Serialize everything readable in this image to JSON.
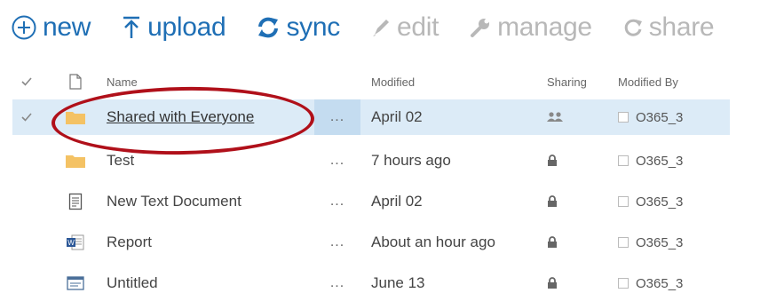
{
  "toolbar": {
    "new_label": "new",
    "upload_label": "upload",
    "sync_label": "sync",
    "edit_label": "edit",
    "manage_label": "manage",
    "share_label": "share"
  },
  "list": {
    "columns": {
      "name": "Name",
      "modified": "Modified",
      "sharing": "Sharing",
      "modified_by": "Modified By"
    },
    "rows": [
      {
        "name": "Shared with Everyone",
        "type": "folder",
        "modified": "April 02",
        "sharing": "shared-people-icon",
        "modified_by": "O365_3",
        "selected": true
      },
      {
        "name": "Test",
        "type": "folder",
        "modified": "7 hours ago",
        "sharing": "lock-icon",
        "modified_by": "O365_3",
        "selected": false
      },
      {
        "name": "New Text Document",
        "type": "text-document",
        "modified": "April 02",
        "sharing": "lock-icon",
        "modified_by": "O365_3",
        "selected": false
      },
      {
        "name": "Report",
        "type": "word-document",
        "modified": "About an hour ago",
        "sharing": "lock-icon",
        "modified_by": "O365_3",
        "selected": false
      },
      {
        "name": "Untitled",
        "type": "generic-document",
        "modified": "June 13",
        "sharing": "lock-icon",
        "modified_by": "O365_3",
        "selected": false
      }
    ],
    "ellipsis": "..."
  },
  "colors": {
    "accent": "#1f6fb5",
    "disabled": "#b8b8b8",
    "selection": "#dcebf7",
    "folder": "#f4c264",
    "annotation": "#b0101a"
  }
}
